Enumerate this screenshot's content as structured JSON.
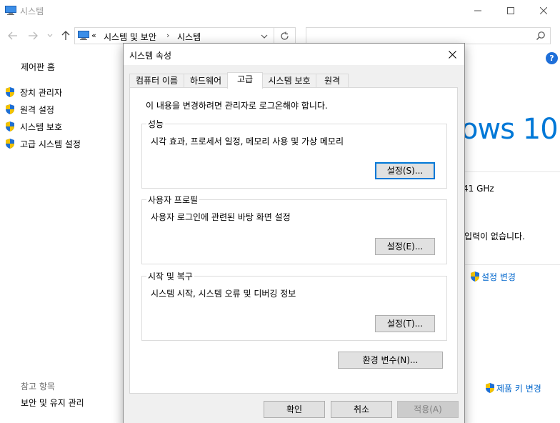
{
  "window": {
    "title": "시스템",
    "icon": "system-monitor-icon"
  },
  "toolbar": {
    "breadcrumb_chevron": "«",
    "breadcrumb": [
      "시스템 및 보안",
      "시스템"
    ],
    "breadcrumb_separator": "›"
  },
  "sidebar": {
    "home": "제어판 홈",
    "items": [
      {
        "label": "장치 관리자",
        "icon": "uac-shield-icon"
      },
      {
        "label": "원격 설정",
        "icon": "uac-shield-icon"
      },
      {
        "label": "시스템 보호",
        "icon": "uac-shield-icon"
      },
      {
        "label": "고급 시스템 설정",
        "icon": "uac-shield-icon"
      }
    ],
    "see_also": "참고 항목",
    "maintenance": "보안 및 유지 관리"
  },
  "main": {
    "windows_logo_text": "ows 10",
    "cpu_speed": "41 GHz",
    "touch_input": "입력이 없습니다.",
    "change_settings": "설정 변경",
    "change_product_key": "제품 키 변경",
    "link_color": "#0066cc"
  },
  "dialog": {
    "title": "시스템 속성",
    "tabs": [
      {
        "label": "컴퓨터 이름",
        "active": false
      },
      {
        "label": "하드웨어",
        "active": false
      },
      {
        "label": "고급",
        "active": true
      },
      {
        "label": "시스템 보호",
        "active": false
      },
      {
        "label": "원격",
        "active": false
      }
    ],
    "admin_note": "이 내용을 변경하려면 관리자로 로그온해야 합니다.",
    "groups": [
      {
        "title": "성능",
        "description": "시각 효과, 프로세서 일정, 메모리 사용 및 가상 메모리",
        "button": "설정(S)..."
      },
      {
        "title": "사용자 프로필",
        "description": "사용자 로그인에 관련된 바탕 화면 설정",
        "button": "설정(E)..."
      },
      {
        "title": "시작 및 복구",
        "description": "시스템 시작, 시스템 오류 및 디버깅 정보",
        "button": "설정(T)..."
      }
    ],
    "env_button": "환경 변수(N)...",
    "ok": "확인",
    "cancel": "취소",
    "apply": "적용(A)"
  },
  "colors": {
    "accent": "#0078d7",
    "focus_border": "#0078d7"
  }
}
